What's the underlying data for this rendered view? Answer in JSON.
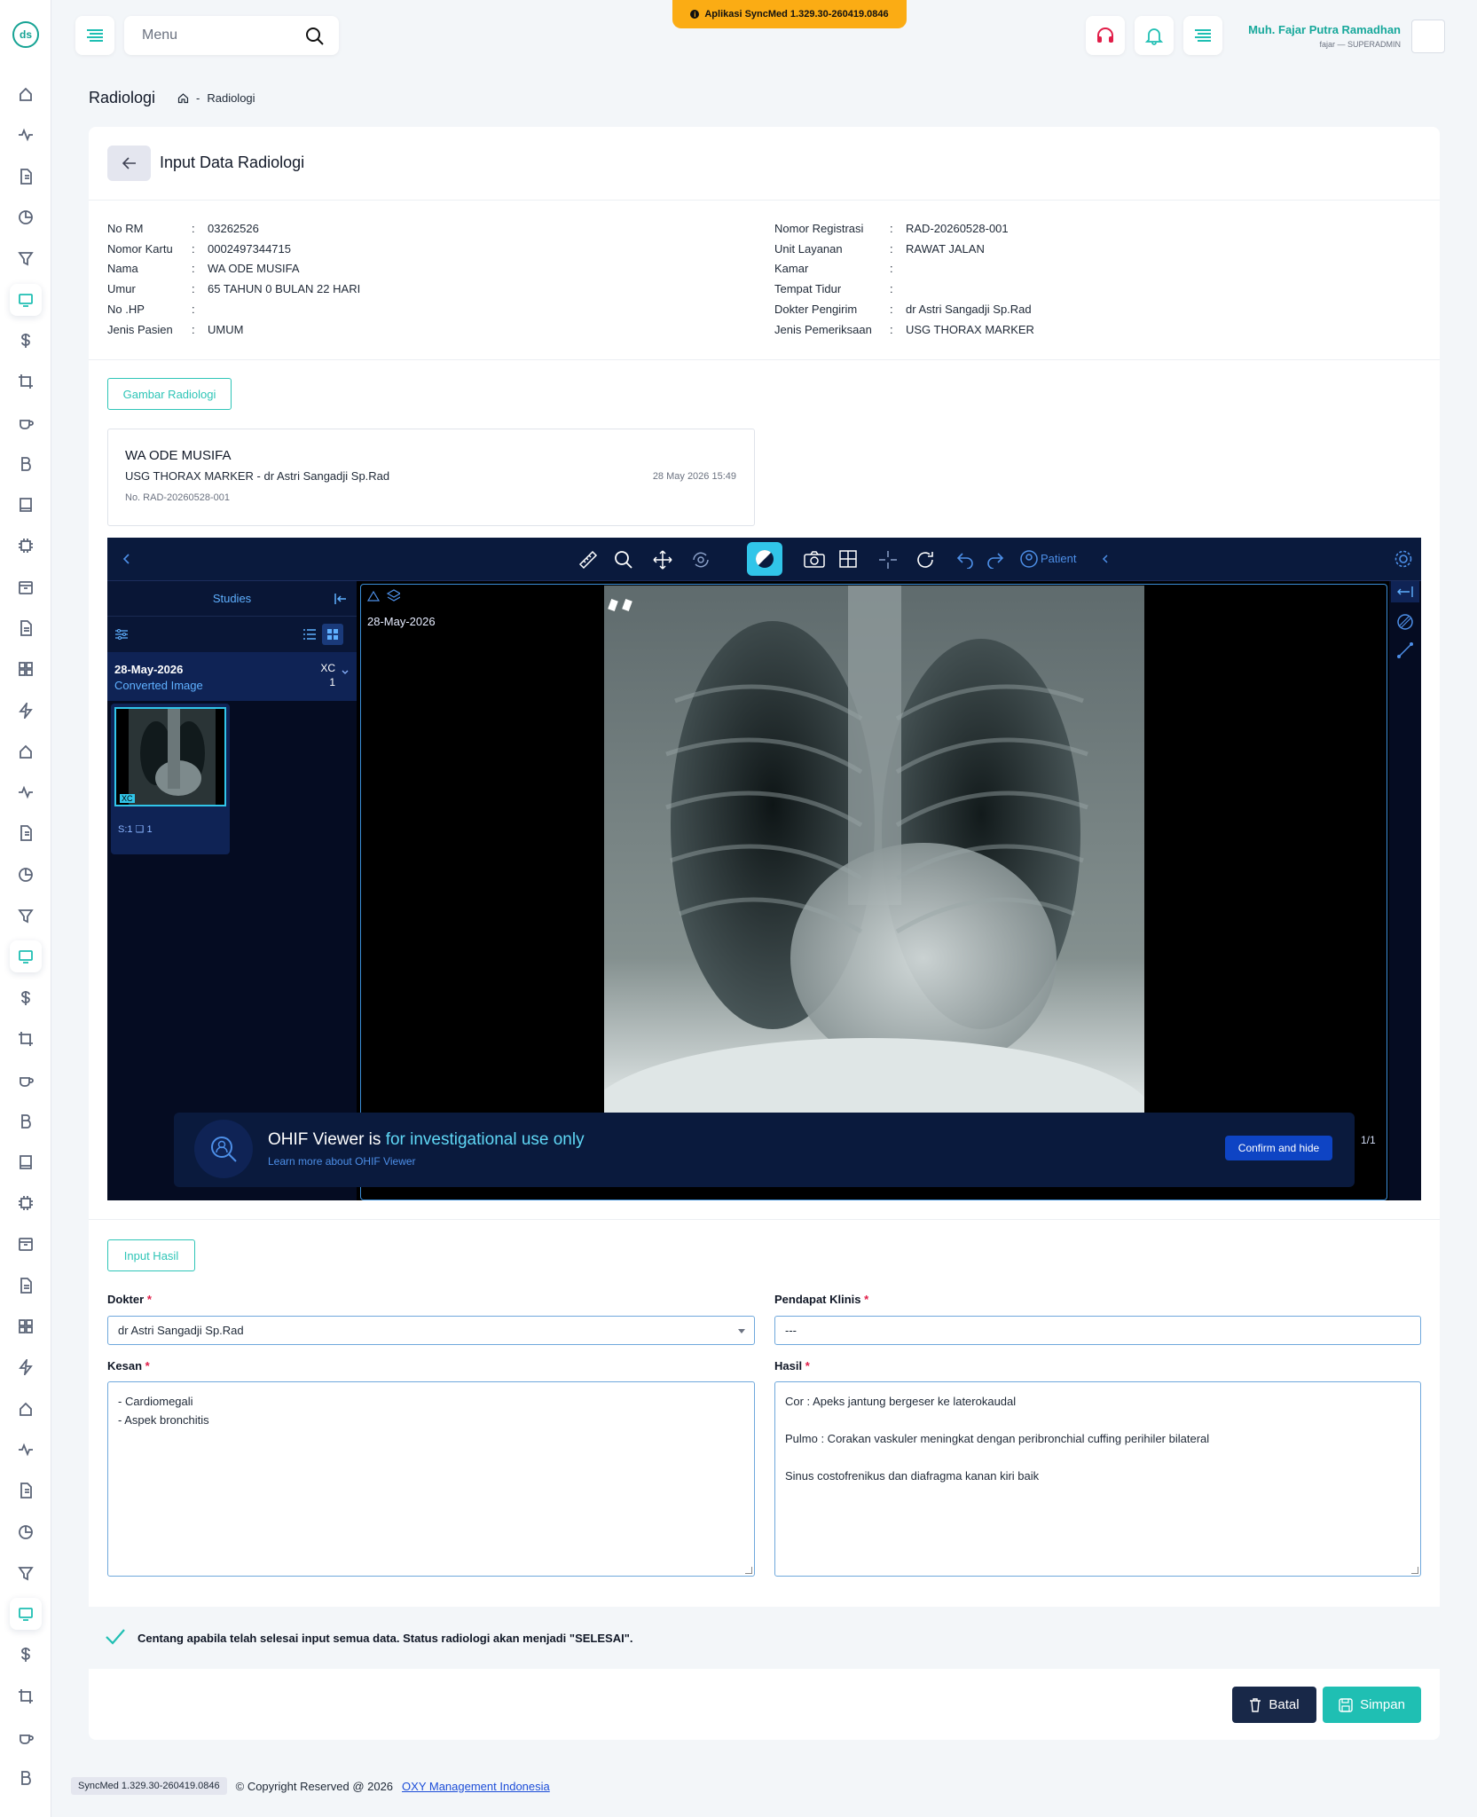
{
  "app": {
    "version_banner": "Aplikasi SyncMed 1.329.30-260419.0846",
    "menu_placeholder": "Menu",
    "user_name": "Muh. Fajar Putra Ramadhan",
    "user_role": "fajar — SUPERADMIN"
  },
  "breadcrumb": {
    "title": "Radiologi",
    "sep": "-",
    "current": "Radiologi"
  },
  "card": {
    "title": "Input Data Radiologi"
  },
  "patient_left": [
    {
      "k": "No RM",
      "v": "03262526"
    },
    {
      "k": "Nomor Kartu",
      "v": "0002497344715"
    },
    {
      "k": "Nama",
      "v": "WA ODE MUSIFA"
    },
    {
      "k": "Umur",
      "v": "65 TAHUN 0 BULAN 22 HARI"
    },
    {
      "k": "No .HP",
      "v": ""
    },
    {
      "k": "Jenis Pasien",
      "v": "UMUM"
    }
  ],
  "patient_right": [
    {
      "k": "Nomor Registrasi",
      "v": "RAD-20260528-001"
    },
    {
      "k": "Unit Layanan",
      "v": "RAWAT JALAN"
    },
    {
      "k": "Kamar",
      "v": ""
    },
    {
      "k": "Tempat Tidur",
      "v": ""
    },
    {
      "k": "Dokter Pengirim",
      "v": "dr Astri Sangadji Sp.Rad"
    },
    {
      "k": "Jenis Pemeriksaan",
      "v": "USG THORAX MARKER"
    }
  ],
  "colon": ":",
  "gambar_btn": "Gambar Radiologi",
  "study": {
    "name": "WA ODE MUSIFA",
    "exam": "USG THORAX MARKER - dr Astri Sangadji Sp.Rad",
    "no": "No. RAD-20260528-001",
    "date": "28 May 2026 15:49"
  },
  "viewer": {
    "patient_label": "Patient",
    "studies_label": "Studies",
    "study_date": "28-May-2026",
    "study_type": "Converted Image",
    "modality": "XC",
    "count": "1",
    "thumb_modality": "XC",
    "thumb_label": "S:1",
    "thumb_count": "1",
    "overlay_date": "28-May-2026",
    "banner_title": "OHIF Viewer is",
    "banner_highlight": "for investigational use only",
    "banner_link": "Learn more about OHIF Viewer",
    "banner_btn": "Confirm and hide",
    "pages": "1/1"
  },
  "input_hasil_btn": "Input Hasil",
  "form": {
    "dokter_label": "Dokter",
    "dokter_value": "dr Astri Sangadji Sp.Rad",
    "pendapat_label": "Pendapat Klinis",
    "pendapat_value": "---",
    "kesan_label": "Kesan",
    "kesan_lines": [
      "- Cardiomegali",
      "- Aspek bronchitis"
    ],
    "hasil_label": "Hasil",
    "hasil_lines": [
      "Cor : Apeks jantung bergeser ke laterokaudal",
      "",
      "Pulmo : Corakan vaskuler meningkat dengan peribronchial cuffing perihiler bilateral",
      "",
      "Sinus costofrenikus dan diafragma kanan kiri baik"
    ],
    "required_mark": "*"
  },
  "confirm_text": "Centang apabila telah selesai input semua data. Status radiologi akan menjadi \"SELESAI\".",
  "buttons": {
    "batal": "Batal",
    "simpan": "Simpan"
  },
  "footer": {
    "version": "SyncMed 1.329.30-260419.0846",
    "copyright": "© Copyright Reserved @ 2026",
    "company": "OXY Management Indonesia"
  },
  "colors": {
    "accent": "#1fbfb3",
    "dark": "#182848",
    "warning": "#fbac14",
    "viewer_bg": "#0a1a3d"
  }
}
